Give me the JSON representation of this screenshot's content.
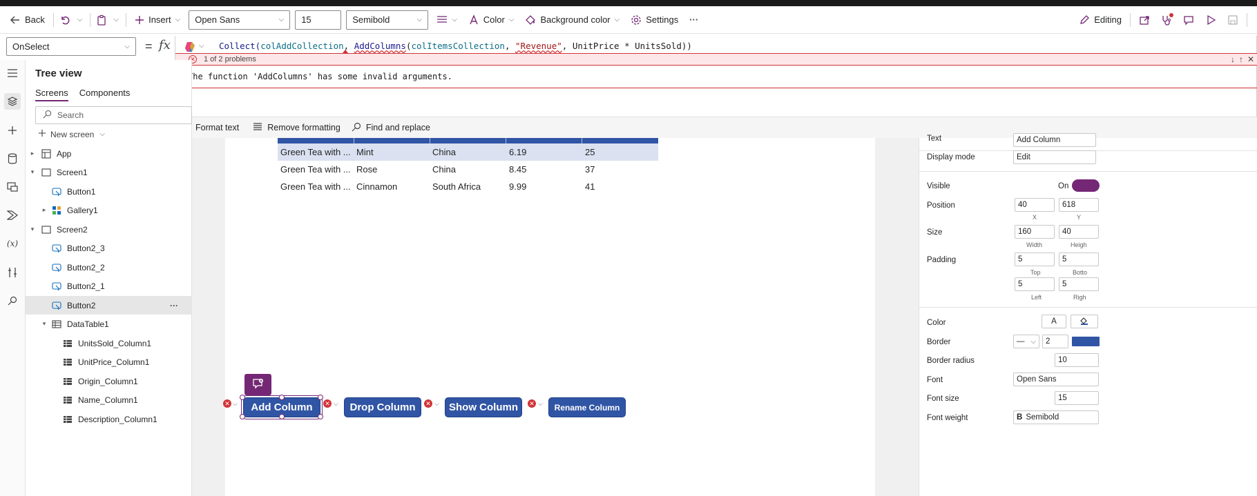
{
  "toolbar": {
    "back": "Back",
    "insert": "Insert",
    "font": "Open Sans",
    "font_size": "15",
    "font_weight": "Semibold",
    "color": "Color",
    "background_color": "Background color",
    "settings": "Settings",
    "more": "···",
    "editing": "Editing",
    "accent": "#742774"
  },
  "formula": {
    "property": "OnSelect",
    "eq": "=",
    "fx": "fx",
    "t1": "Collect(",
    "t2": "colAddCollection",
    "t3": ", ",
    "t4": "AddColumns",
    "t5": "(",
    "t6": "colItemsCollection",
    "t7": ", ",
    "t8": "\"Revenue\"",
    "t9": ", UnitPrice * UnitsSold))",
    "problems": "1 of 2 problems",
    "error_message": "The function 'AddColumns' has some invalid arguments.",
    "format_text": "Format text",
    "remove_formatting": "Remove formatting",
    "find_replace": "Find and replace"
  },
  "tree": {
    "title": "Tree view",
    "tab_screens": "Screens",
    "tab_components": "Components",
    "search_placeholder": "Search",
    "new_screen": "New screen",
    "items": [
      {
        "label": "App"
      },
      {
        "label": "Screen1"
      },
      {
        "label": "Button1"
      },
      {
        "label": "Gallery1"
      },
      {
        "label": "Screen2"
      },
      {
        "label": "Button2_3"
      },
      {
        "label": "Button2_2"
      },
      {
        "label": "Button2_1"
      },
      {
        "label": "Button2"
      },
      {
        "label": "DataTable1"
      },
      {
        "label": "UnitsSold_Column1"
      },
      {
        "label": "UnitPrice_Column1"
      },
      {
        "label": "Origin_Column1"
      },
      {
        "label": "Name_Column1"
      },
      {
        "label": "Description_Column1"
      }
    ],
    "more": "···"
  },
  "table": {
    "rows": [
      [
        "Green Tea with ...",
        "Mint",
        "China",
        "6.19",
        "25"
      ],
      [
        "Green Tea with ...",
        "Rose",
        "China",
        "8.45",
        "37"
      ],
      [
        "Green Tea with ...",
        "Cinnamon",
        "South Africa",
        "9.99",
        "41"
      ]
    ]
  },
  "buttons": {
    "add": "Add Column",
    "drop": "Drop Column",
    "show": "Show Column",
    "rename": "Rename Column"
  },
  "properties": {
    "text_label": "Text",
    "text_value": "Add Column",
    "display_mode_label": "Display mode",
    "display_mode_value": "Edit",
    "visible_label": "Visible",
    "visible_value": "On",
    "position_label": "Position",
    "x": "40",
    "y": "618",
    "x_label": "X",
    "y_label": "Y",
    "size_label": "Size",
    "width": "160",
    "height": "40",
    "width_label": "Width",
    "height_label": "Heigh",
    "padding_label": "Padding",
    "pad_top": "5",
    "pad_bottom": "5",
    "pad_left": "5",
    "pad_right": "5",
    "top_label": "Top",
    "bottom_label": "Botto",
    "left_label": "Left",
    "right_label": "Righ",
    "color_label": "Color",
    "color_glyph": "A",
    "border_label": "Border",
    "border_style": "—",
    "border_width": "2",
    "border_radius_label": "Border radius",
    "border_radius": "10",
    "font_label": "Font",
    "font_value": "Open Sans",
    "font_size_label": "Font size",
    "font_size_value": "15",
    "font_weight_label": "Font weight",
    "font_weight_glyph": "B",
    "font_weight_value": "Semibold",
    "button_fill": "#3155a5"
  }
}
